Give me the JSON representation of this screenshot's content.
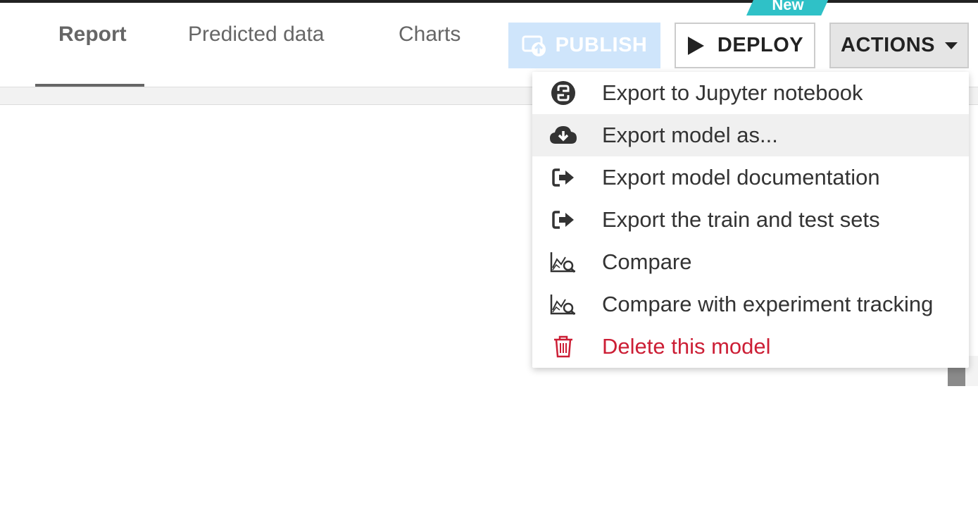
{
  "tabs": [
    {
      "label": "Report",
      "active": true
    },
    {
      "label": "Predicted data",
      "active": false
    },
    {
      "label": "Charts",
      "active": false
    }
  ],
  "buttons": {
    "publish": "PUBLISH",
    "deploy": "DEPLOY",
    "actions": "ACTIONS",
    "new_badge": "New"
  },
  "menu": {
    "items": [
      {
        "label": "Export to Jupyter notebook",
        "icon": "python-icon"
      },
      {
        "label": "Export model as...",
        "icon": "cloud-download-icon",
        "highlighted": true
      },
      {
        "label": "Export model documentation",
        "icon": "export-icon"
      },
      {
        "label": "Export the train and test sets",
        "icon": "export-icon"
      },
      {
        "label": "Compare",
        "icon": "chart-compare-icon"
      },
      {
        "label": "Compare with experiment tracking",
        "icon": "chart-compare-icon"
      },
      {
        "label": "Delete this model",
        "icon": "trash-icon",
        "danger": true
      }
    ]
  },
  "colors": {
    "accent_new": "#2fc1c7",
    "publish_bg": "#cfe5fb",
    "danger": "#cc1e35",
    "hover_bg": "#f0f0f0"
  }
}
